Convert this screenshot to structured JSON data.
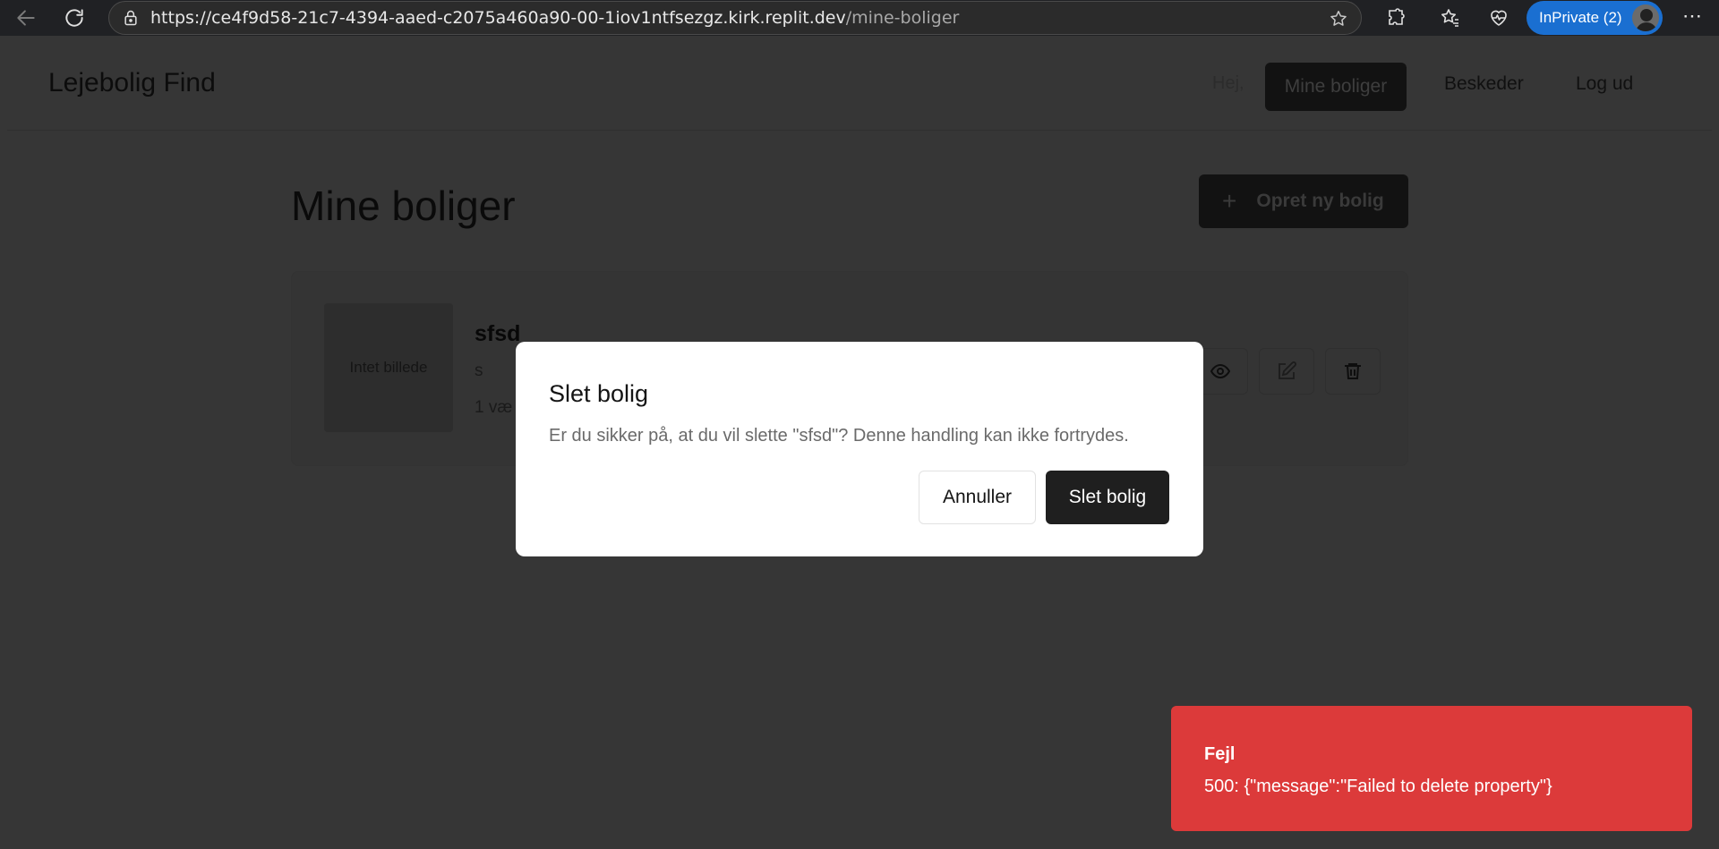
{
  "browser": {
    "url_host": "https://ce4f9d58-21c7-4394-aaed-c2075a460a90-00-1iov1ntfsezgz.kirk.replit.dev",
    "url_path": "/mine-boliger",
    "inprivate_label": "InPrivate (2)",
    "more_label": "⋯"
  },
  "header": {
    "brand": "Lejebolig Find",
    "greeting": "Hej,",
    "nav": {
      "mine_boliger": "Mine boliger",
      "beskeder": "Beskeder",
      "log_ud": "Log ud"
    }
  },
  "main": {
    "title": "Mine boliger",
    "create_button": "Opret ny bolig",
    "create_plus": "+",
    "property": {
      "image_placeholder": "Intet billede",
      "title": "sfsd",
      "description": "s",
      "rooms": "1 væ"
    }
  },
  "modal": {
    "title": "Slet bolig",
    "description": "Er du sikker på, at du vil slette \"sfsd\"? Denne handling kan ikke fortrydes.",
    "cancel_label": "Annuller",
    "confirm_label": "Slet bolig"
  },
  "toast": {
    "title": "Fejl",
    "message": "500: {\"message\":\"Failed to delete property\"}"
  },
  "colors": {
    "toast_bg": "#dc3a3a",
    "inprivate_bg": "#1a6fd1",
    "overlay_bg": "#363636",
    "primary_button": "#1f1f1f"
  }
}
